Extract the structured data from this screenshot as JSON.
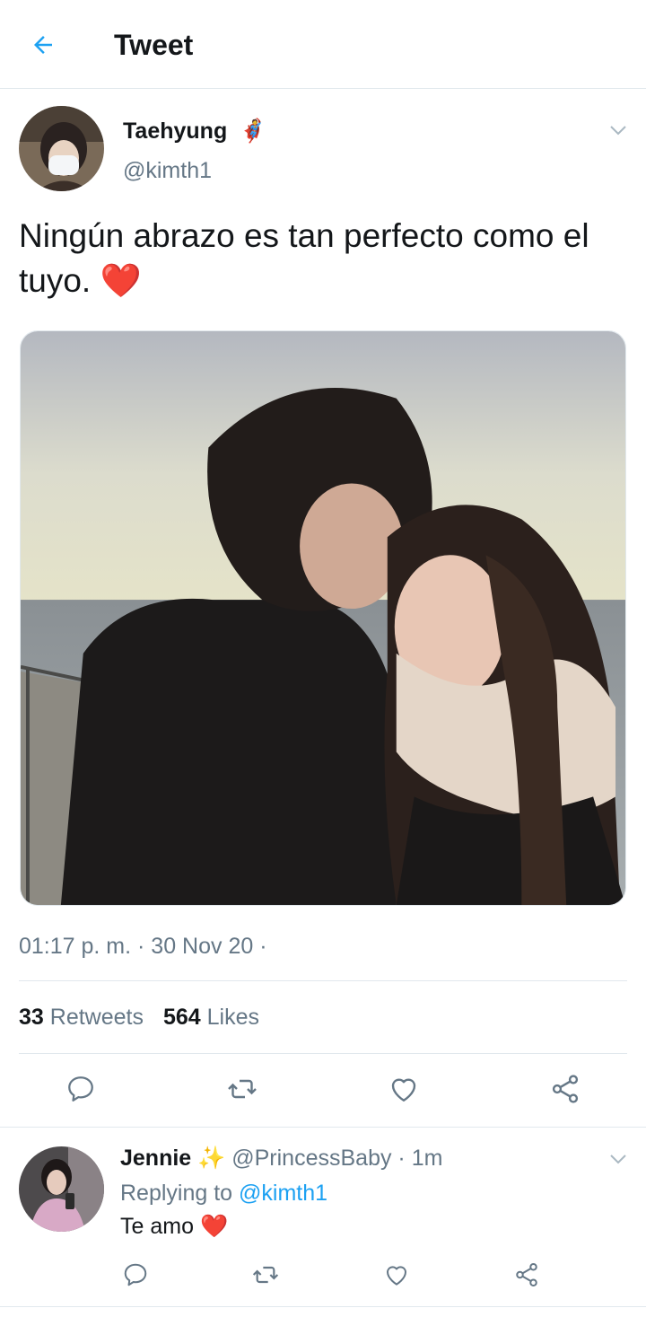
{
  "header": {
    "title": "Tweet"
  },
  "tweet": {
    "author_name": "Taehyung",
    "author_emoji": "🦸",
    "handle": "@kimth1",
    "text": "Ningún abrazo es tan perfecto como el tuyo.",
    "text_emoji": "❤️",
    "timestamp": "01:17 p. m. · 30 Nov 20 ·",
    "retweets_count": "33",
    "retweets_label": "Retweets",
    "likes_count": "564",
    "likes_label": "Likes"
  },
  "reply": {
    "author_name": "Jennie",
    "author_emoji": "✨",
    "handle_time": "@PrincessBaby · 1m",
    "replying_prefix": "Replying to",
    "replying_handle": "@kimth1",
    "text": "Te amo",
    "text_emoji": "❤️"
  },
  "colors": {
    "accent": "#1da1f2",
    "secondary_text": "#657786",
    "divider": "#e1e8ed",
    "heart": "#e0142b"
  },
  "icons": [
    "back-arrow-icon",
    "chevron-down-icon",
    "reply-icon",
    "retweet-icon",
    "like-icon",
    "share-icon"
  ]
}
